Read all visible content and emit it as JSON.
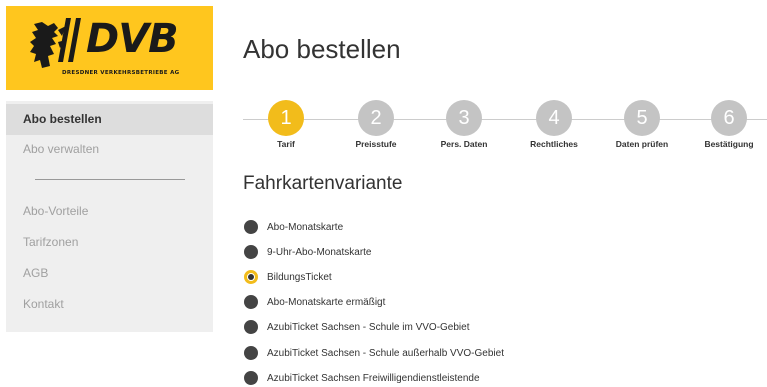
{
  "brand": {
    "name": "DVB",
    "tagline": "DRESDNER VERKEHRSBETRIEBE AG",
    "color": "#ffc61e"
  },
  "sidebar": {
    "items": [
      {
        "label": "Abo bestellen",
        "active": true
      },
      {
        "label": "Abo verwalten",
        "active": false
      },
      {
        "label": "Abo-Vorteile",
        "active": false
      },
      {
        "label": "Tarifzonen",
        "active": false
      },
      {
        "label": "AGB",
        "active": false
      },
      {
        "label": "Kontakt",
        "active": false
      }
    ]
  },
  "main": {
    "title": "Abo bestellen",
    "steps": [
      {
        "number": "1",
        "label": "Tarif",
        "active": true
      },
      {
        "number": "2",
        "label": "Preisstufe",
        "active": false
      },
      {
        "number": "3",
        "label": "Pers. Daten",
        "active": false
      },
      {
        "number": "4",
        "label": "Rechtliches",
        "active": false
      },
      {
        "number": "5",
        "label": "Daten prüfen",
        "active": false
      },
      {
        "number": "6",
        "label": "Bestätigung",
        "active": false
      }
    ],
    "section_title": "Fahrkartenvariante",
    "options": [
      {
        "label": "Abo-Monatskarte",
        "selected": false
      },
      {
        "label": "9-Uhr-Abo-Monatskarte",
        "selected": false
      },
      {
        "label": "BildungsTicket",
        "selected": true
      },
      {
        "label": "Abo-Monatskarte ermäßigt",
        "selected": false
      },
      {
        "label": "AzubiTicket Sachsen - Schule im VVO-Gebiet",
        "selected": false
      },
      {
        "label": "AzubiTicket Sachsen - Schule außerhalb VVO-Gebiet",
        "selected": false
      },
      {
        "label": "AzubiTicket Sachsen Freiwilligendienstleistende",
        "selected": false
      }
    ]
  },
  "colors": {
    "accent": "#f2bc1b",
    "step_inactive": "#c4c4c4",
    "sidebar_bg": "#efefef",
    "sidebar_active_bg": "#dddddd"
  }
}
